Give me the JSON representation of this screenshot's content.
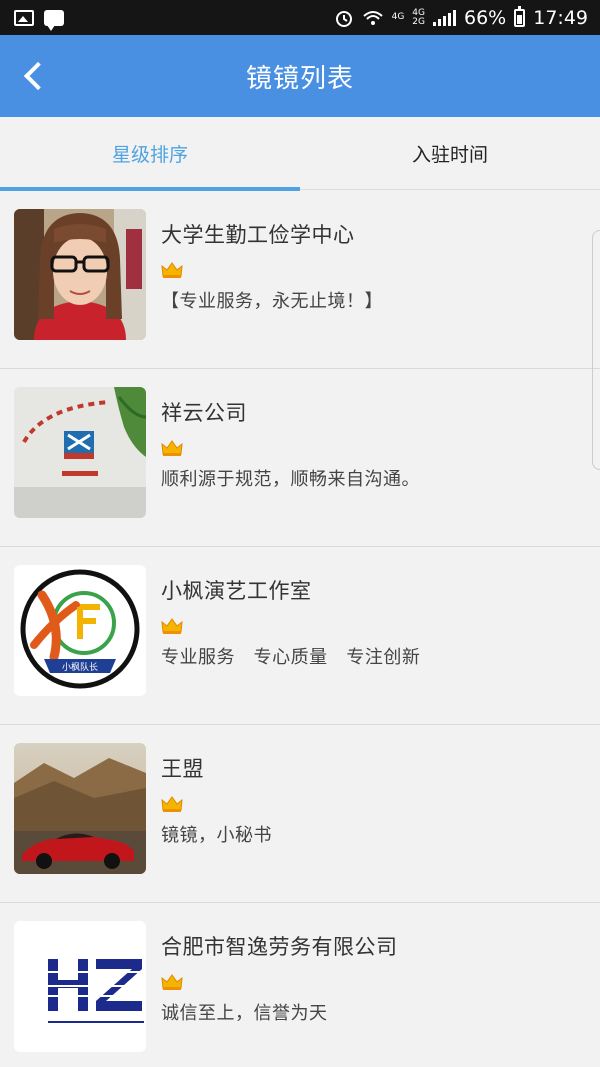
{
  "status_bar": {
    "battery": "66%",
    "time": "17:49",
    "net_top": "4G",
    "net_mid_top": "4G",
    "net_mid_bottom": "2G"
  },
  "header": {
    "title": "镜镜列表"
  },
  "tabs": [
    {
      "label": "星级排序",
      "active": true
    },
    {
      "label": "入驻时间",
      "active": false
    }
  ],
  "items": [
    {
      "name": "大学生勤工俭学中心",
      "slogan": "【专业服务，永无止境！】",
      "icon": "crown-icon"
    },
    {
      "name": "祥云公司",
      "slogan": "顺利源于规范，顺畅来自沟通。",
      "icon": "crown-icon"
    },
    {
      "name": "小枫演艺工作室",
      "slogan": "专业服务   专心质量   专注创新",
      "icon": "crown-icon",
      "logo_text": "小枫队长"
    },
    {
      "name": "王盟",
      "slogan": "镜镜，小秘书",
      "icon": "crown-icon"
    },
    {
      "name": "合肥市智逸劳务有限公司",
      "slogan": "诚信至上，信誉为天",
      "icon": "crown-icon"
    }
  ],
  "colors": {
    "header": "#4a90e2",
    "active_tab": "#4fa3e0",
    "background": "#f2f2f2",
    "crown": "#f4b400"
  }
}
